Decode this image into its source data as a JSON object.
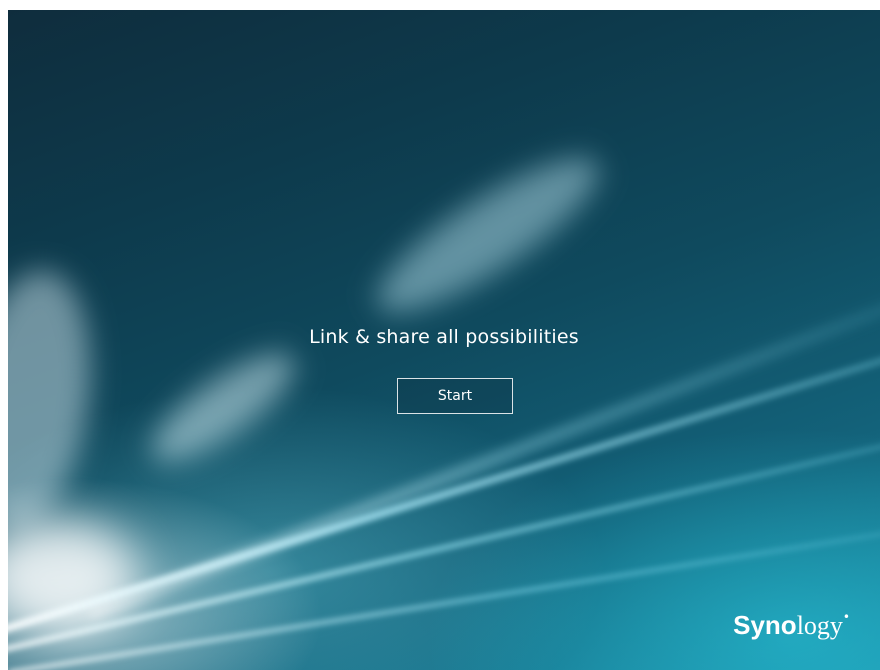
{
  "welcome": {
    "tagline": "Link & share all possibilities",
    "start_label": "Start"
  },
  "brand": {
    "logo_bold": "Syno",
    "logo_light": "logy",
    "logo_mark": "•"
  },
  "colors": {
    "background_dark": "#0f2d3d",
    "background_light": "#1c8ea8",
    "text": "#ffffff"
  }
}
